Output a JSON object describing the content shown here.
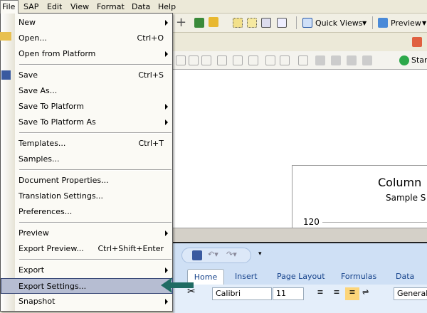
{
  "menubar": [
    "File",
    "SAP",
    "Edit",
    "View",
    "Format",
    "Data",
    "Help"
  ],
  "toolbar": {
    "quick_views": "Quick Views",
    "preview": "Preview",
    "start": "Star"
  },
  "file_menu": [
    {
      "label": "New",
      "shortcut": "",
      "submenu": true
    },
    {
      "label": "Open...",
      "shortcut": "Ctrl+O",
      "submenu": false
    },
    {
      "label": "Open from Platform",
      "shortcut": "",
      "submenu": true
    },
    {
      "label": "Save",
      "shortcut": "Ctrl+S",
      "submenu": false
    },
    {
      "label": "Save As...",
      "shortcut": "",
      "submenu": false
    },
    {
      "label": "Save To Platform",
      "shortcut": "",
      "submenu": true
    },
    {
      "label": "Save To Platform As",
      "shortcut": "",
      "submenu": true
    },
    {
      "label": "Templates...",
      "shortcut": "Ctrl+T",
      "submenu": false
    },
    {
      "label": "Samples...",
      "shortcut": "",
      "submenu": false
    },
    {
      "label": "Document Properties...",
      "shortcut": "",
      "submenu": false
    },
    {
      "label": "Translation Settings...",
      "shortcut": "",
      "submenu": false
    },
    {
      "label": "Preferences...",
      "shortcut": "",
      "submenu": false
    },
    {
      "label": "Preview",
      "shortcut": "",
      "submenu": true
    },
    {
      "label": "Export Preview...",
      "shortcut": "Ctrl+Shift+Enter",
      "submenu": false
    },
    {
      "label": "Export",
      "shortcut": "",
      "submenu": true
    },
    {
      "label": "Export Settings...",
      "shortcut": "",
      "submenu": false,
      "highlighted": true
    },
    {
      "label": "Snapshot",
      "shortcut": "",
      "submenu": true
    }
  ],
  "chart": {
    "title": "Column",
    "subtitle": "Sample S",
    "y_tick": "120"
  },
  "excel": {
    "tabs": [
      "Home",
      "Insert",
      "Page Layout",
      "Formulas",
      "Data"
    ],
    "font": "Calibri",
    "size": "11",
    "number_format": "General"
  },
  "colors": {
    "highlight": "#b6bdd2",
    "arrow": "#1f6b63"
  }
}
